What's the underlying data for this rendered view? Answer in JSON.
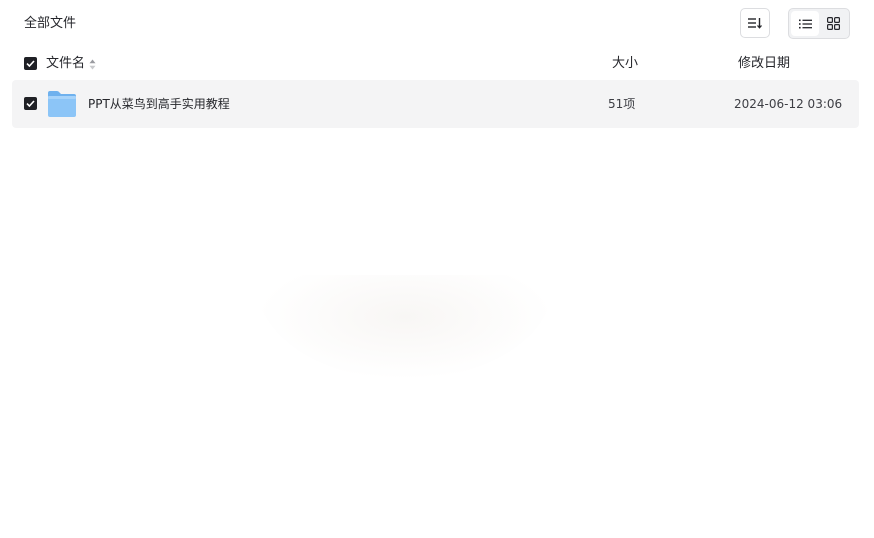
{
  "breadcrumb": {
    "label": "全部文件"
  },
  "toolbar": {
    "sort_icon": "sort-list-icon",
    "view_options": [
      {
        "name": "list-view",
        "icon": "list-icon",
        "active": true
      },
      {
        "name": "grid-view",
        "icon": "grid-icon",
        "active": false
      }
    ]
  },
  "table": {
    "headers": {
      "name": "文件名",
      "size": "大小",
      "date": "修改日期"
    },
    "select_all_checked": true,
    "rows": [
      {
        "checked": true,
        "icon": "folder-icon",
        "name": "PPT从菜鸟到高手实用教程",
        "size": "51项",
        "date": "2024-06-12 03:06"
      }
    ]
  },
  "colors": {
    "checkbox": "#1f2025",
    "row_highlight": "#f4f4f5",
    "folder": "#8cc5f7"
  }
}
